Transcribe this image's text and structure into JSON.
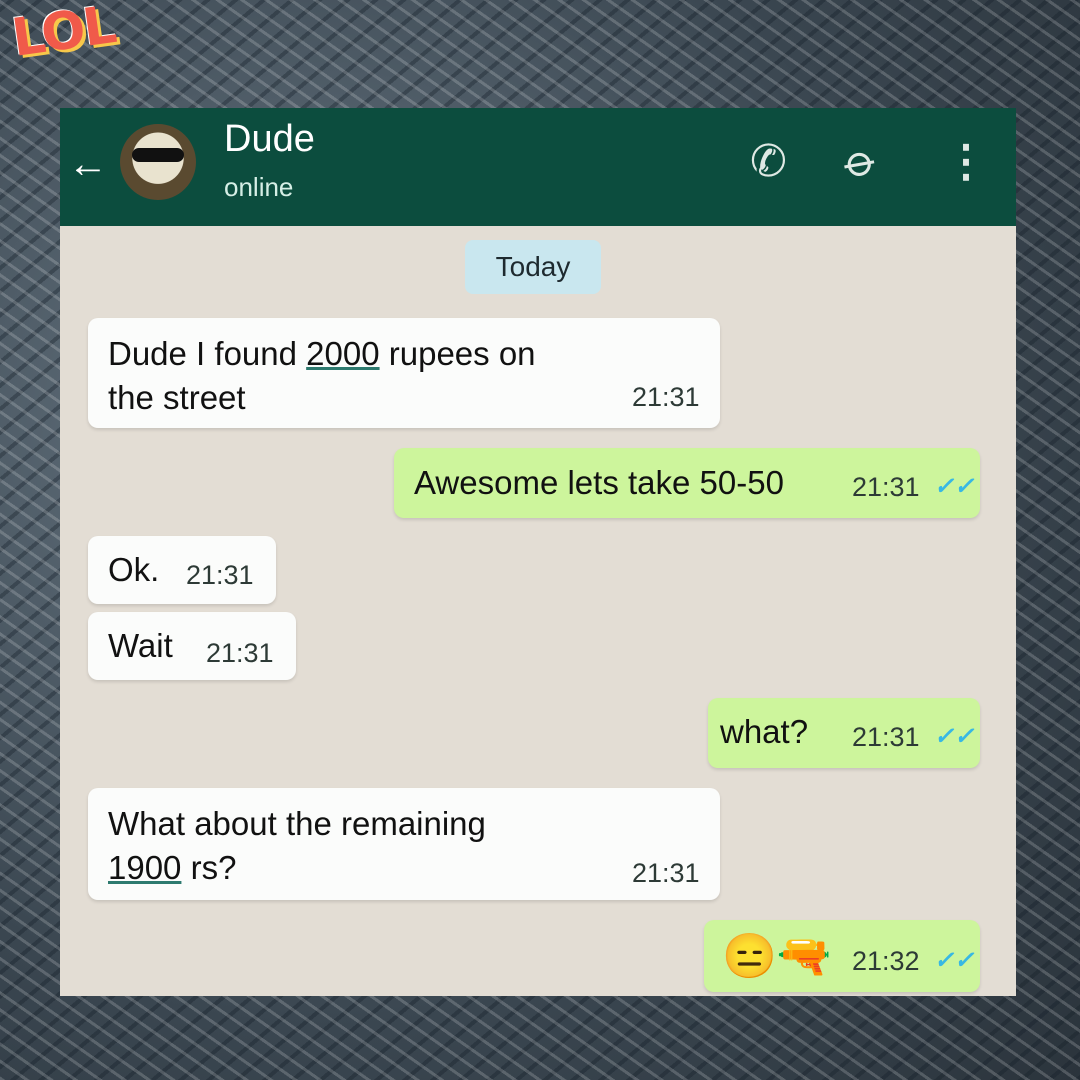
{
  "watermark": "LOL",
  "header": {
    "contact_name": "Dude",
    "status": "online",
    "icons": {
      "back": "arrow-left-icon",
      "call": "phone-icon",
      "attach": "paperclip-icon",
      "menu": "more-vert-icon"
    }
  },
  "date_divider": "Today",
  "messages": [
    {
      "direction": "in",
      "line1_pre": "Dude I found ",
      "line1_num": "2000",
      "line1_post": " rupees on",
      "line2": "the street",
      "time": "21:31"
    },
    {
      "direction": "out",
      "text": "Awesome lets take 50-50",
      "time": "21:31",
      "read": true
    },
    {
      "direction": "in",
      "text": "Ok.",
      "time": "21:31"
    },
    {
      "direction": "in",
      "text": "Wait",
      "time": "21:31"
    },
    {
      "direction": "out",
      "text": "what?",
      "time": "21:31",
      "read": true
    },
    {
      "direction": "in",
      "line1": "What about the remaining",
      "line2_num": "1900",
      "line2_post": " rs?",
      "time": "21:31"
    },
    {
      "direction": "out",
      "text": "😑🔫",
      "time": "21:32",
      "read": true
    }
  ],
  "read_ticks": "✓✓",
  "colors": {
    "header": "#0c4d3e",
    "outgoing": "#cdf59c",
    "incoming": "#fbfcfb",
    "ticks": "#38b8e3"
  }
}
